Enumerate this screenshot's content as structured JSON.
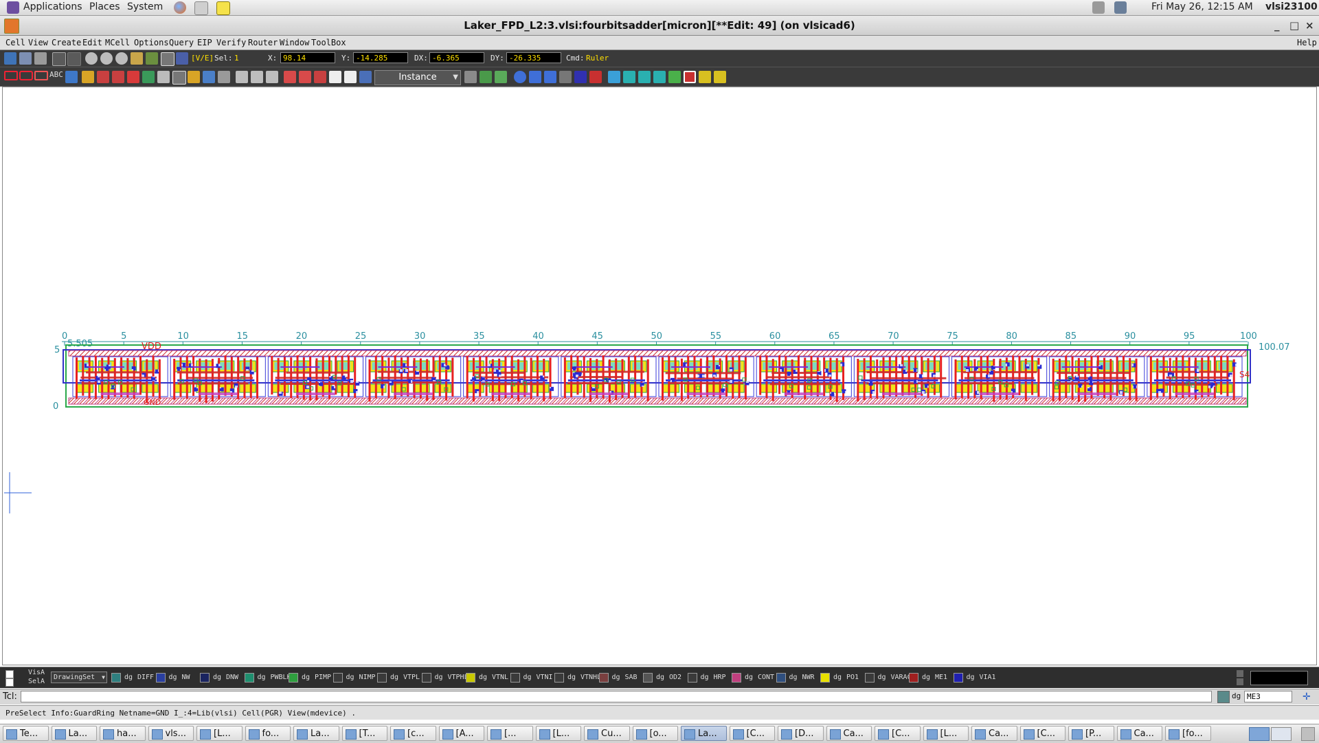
{
  "system_panel": {
    "menus": [
      "Applications",
      "Places",
      "System"
    ],
    "clock": "Fri May 26, 12:15 AM",
    "user": "vlsi23100"
  },
  "window": {
    "title": "Laker_FPD_L2:3.vlsi:fourbitsadder[micron][**Edit: 49] (on vlsicad6)",
    "buttons": [
      "_",
      "□",
      "×"
    ]
  },
  "menubar": {
    "items": [
      "Cell",
      "View",
      "Create",
      "Edit",
      "MCell",
      "Options",
      "Query",
      "EIP",
      "Verify",
      "Router",
      "Window",
      "ToolBox"
    ],
    "help": "Help"
  },
  "toolbar": {
    "mode": "[V/E]",
    "sel_label": "Sel:",
    "sel_value": "1",
    "x_label": "X:",
    "x_value": "98.14",
    "y_label": "Y:",
    "y_value": "-14.285",
    "dx_label": "DX:",
    "dx_value": "-6.365",
    "dy_label": "DY:",
    "dy_value": "-26.335",
    "cmd_label": "Cmd:",
    "cmd_value": "Ruler",
    "object_type": "Instance"
  },
  "canvas": {
    "ruler_ticks": [
      "0",
      "5",
      "10",
      "15",
      "20",
      "25",
      "30",
      "35",
      "40",
      "45",
      "50",
      "55",
      "60",
      "65",
      "70",
      "75",
      "80",
      "85",
      "90",
      "95",
      "100"
    ],
    "ruler_end": "100.07",
    "y_top_label": "5",
    "y_zero_label": "0",
    "height_label": "5.505",
    "net_vdd": "VDD",
    "net_gnd": "GND",
    "pin_s4": "S4"
  },
  "layerbar": {
    "vis_label": "VisA",
    "sel_label": "SelA",
    "drawing_set": "DrawingSet",
    "dg": "dg",
    "layers": [
      {
        "name": "DIFF",
        "color": "#2f7f7f"
      },
      {
        "name": "NW",
        "color": "#2a3fa0"
      },
      {
        "name": "DNW",
        "color": "#1a2460"
      },
      {
        "name": "PWBLK",
        "color": "#1f8f6f"
      },
      {
        "name": "PIMP",
        "color": "#2f9f3f"
      },
      {
        "name": "NIMP",
        "color": "#3a3a3a"
      },
      {
        "name": "VTPL",
        "color": "#3a3a3a"
      },
      {
        "name": "VTPHL",
        "color": "#3a3a3a"
      },
      {
        "name": "VTNL",
        "color": "#c8c800"
      },
      {
        "name": "VTNI",
        "color": "#3a3a3a"
      },
      {
        "name": "VTNHL",
        "color": "#3a3a3a"
      },
      {
        "name": "SAB",
        "color": "#7a3f3f"
      },
      {
        "name": "OD2",
        "color": "#555555"
      },
      {
        "name": "HRP",
        "color": "#3a3a3a"
      },
      {
        "name": "CONT",
        "color": "#c03f7f"
      },
      {
        "name": "NWR",
        "color": "#2f4f7f"
      },
      {
        "name": "PO1",
        "color": "#e8e000"
      },
      {
        "name": "VARAC",
        "color": "#3a3a3a"
      },
      {
        "name": "ME1",
        "color": "#a02020"
      },
      {
        "name": "VIA1",
        "color": "#2020b0"
      }
    ]
  },
  "tcl": {
    "label": "Tcl:",
    "current_layer_dg": "dg",
    "current_layer": "ME3"
  },
  "status": {
    "message": "PreSelect Info:GuardRing Netname=GND I_:4=Lib(vlsi) Cell(PGR) View(mdevice)  ."
  },
  "taskbar": {
    "tasks": [
      "Te...",
      "La...",
      "ha...",
      "vls...",
      "[L...",
      "fo...",
      "La...",
      "[T...",
      "[c...",
      "[A...",
      "[...",
      "[L...",
      "Cu...",
      "[o...",
      "La...",
      "[C...",
      "[D...",
      "Ca...",
      "[C...",
      "[L...",
      "Ca...",
      "[C...",
      "[P...",
      "Ca...",
      "[fo..."
    ],
    "active_index": 14
  }
}
